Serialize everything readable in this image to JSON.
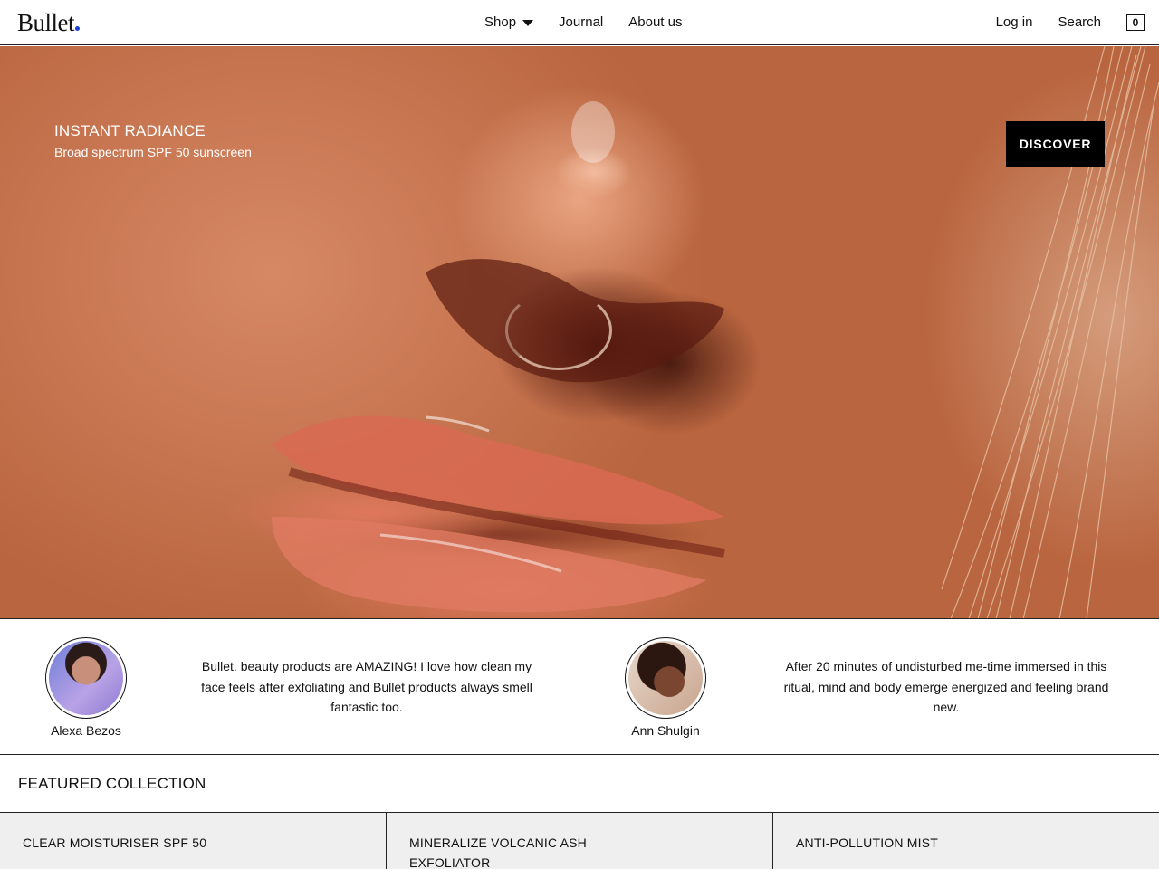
{
  "header": {
    "logo": "Bullet",
    "nav": [
      {
        "label": "Shop"
      },
      {
        "label": "Journal"
      },
      {
        "label": "About us"
      }
    ],
    "login_label": "Log in",
    "search_label": "Search",
    "cart_count": "0"
  },
  "hero": {
    "title": "INSTANT RADIANCE",
    "subtitle": "Broad spectrum SPF 50 sunscreen",
    "cta_label": "DISCOVER"
  },
  "testimonials": [
    {
      "name": "Alexa Bezos",
      "quote": "Bullet. beauty products are AMAZING! I love how clean my face feels after exfoliating and Bullet products always smell fantastic too."
    },
    {
      "name": "Ann Shulgin",
      "quote": "After 20 minutes of undisturbed me-time immersed in this ritual, mind and body emerge energized and feeling brand new."
    }
  ],
  "featured": {
    "title": "FEATURED COLLECTION",
    "products": [
      {
        "name": "CLEAR MOISTURISER SPF 50"
      },
      {
        "name": "MINERALIZE VOLCANIC ASH EXFOLIATOR"
      },
      {
        "name": "ANTI-POLLUTION MIST"
      }
    ]
  },
  "colors": {
    "logo_dot": "#1a3fd6",
    "border": "#222222",
    "product_bg": "#efefef",
    "button_bg": "#000000"
  }
}
